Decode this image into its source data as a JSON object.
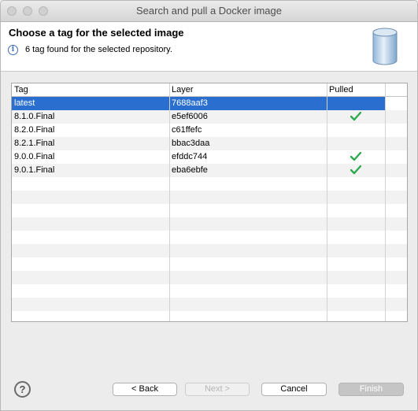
{
  "window": {
    "title": "Search and pull a Docker image"
  },
  "header": {
    "title": "Choose a tag for the selected image",
    "message": "6 tag found for the selected repository."
  },
  "table": {
    "columns": [
      "Tag",
      "Layer",
      "Pulled"
    ],
    "rows": [
      {
        "tag": "latest",
        "layer": "7688aaf3",
        "pulled": false,
        "selected": true
      },
      {
        "tag": "8.1.0.Final",
        "layer": "e5ef6006",
        "pulled": true,
        "selected": false
      },
      {
        "tag": "8.2.0.Final",
        "layer": "c61ffefc",
        "pulled": false,
        "selected": false
      },
      {
        "tag": "8.2.1.Final",
        "layer": "bbac3daa",
        "pulled": false,
        "selected": false
      },
      {
        "tag": "9.0.0.Final",
        "layer": "efddc744",
        "pulled": true,
        "selected": false
      },
      {
        "tag": "9.0.1.Final",
        "layer": "eba6ebfe",
        "pulled": true,
        "selected": false
      }
    ]
  },
  "buttons": {
    "help": "?",
    "back": "< Back",
    "next": "Next >",
    "cancel": "Cancel",
    "finish": "Finish"
  },
  "icons": {
    "info": "info-icon",
    "database": "database-icon",
    "check": "check-icon",
    "help": "help-icon"
  },
  "colors": {
    "selection": "#2a6fcf",
    "check": "#2fa84f"
  }
}
